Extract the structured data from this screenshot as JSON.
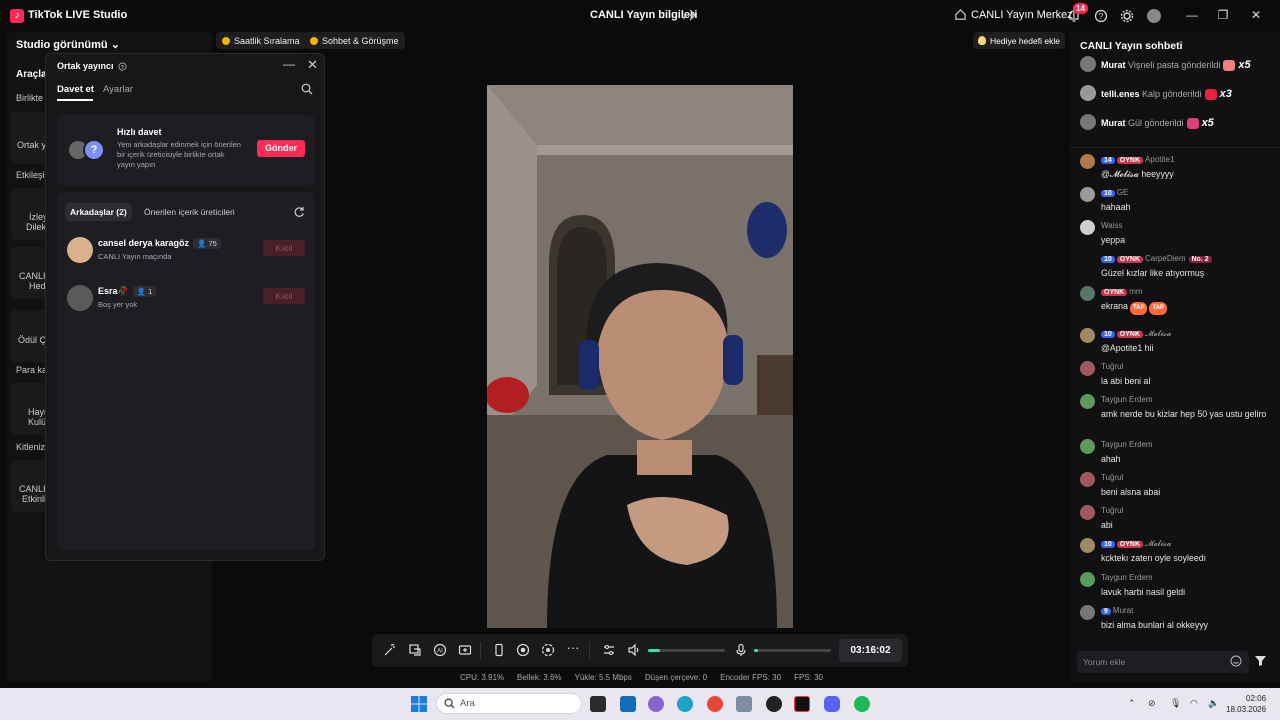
{
  "titlebar": {
    "app_title": "TikTok LIVE Studio",
    "stream_title": "CANLI Yayın bilgileri",
    "live_center": "CANLI Yayın Merkezi",
    "notification_count": "14"
  },
  "left_panel": {
    "studio_view": "Studio görünümü",
    "tools_heading": "Araçlar",
    "sections": {
      "birlikte": "Birlikte",
      "etkilesim": "Etkileşim",
      "para": "Para ka",
      "kitle": "Kitleniz"
    },
    "tiles": {
      "ortak": "Ortak y",
      "izleyici_1": "İzley",
      "izleyici_2": "Dilek",
      "canli_1": "CANLI",
      "canli_2": "Hed",
      "odul": "Ödül Ça",
      "hayran_1": "Hayr",
      "hayran_2": "Kulü",
      "canli_e_1": "CANLI",
      "canli_e_2": "Etkinli"
    }
  },
  "tags": {
    "hourly": "Saatlik Sıralama",
    "chat_meet": "Sohbet & Görüşme",
    "gift_goal": "Hediye hedefi ekle"
  },
  "popup": {
    "title": "Ortak yayıncı",
    "tab_invite": "Davet et",
    "tab_settings": "Ayarlar",
    "quick_title": "Hızlı davet",
    "quick_desc": "Yeni arkadaşlar edinmek için önerilen bir içerik üreticisiyle birlikte ortak yayın yapın",
    "send_label": "Gönder",
    "friends_tab": "Arkadaşlar (2)",
    "suggested_tab": "Önerilen içerik üreticileri",
    "friends": [
      {
        "name": "cansel derya karagöz",
        "count": "75",
        "status": "CANLI Yayın maçında",
        "join": "Katıl"
      },
      {
        "name": "Esra🥀",
        "count": "1",
        "status": "Boş yer yok",
        "join": "Katıl"
      }
    ]
  },
  "controls": {
    "timer": "03:16:02",
    "volume_level": 0.15,
    "mic_level": 0.05
  },
  "stats": {
    "cpu": "CPU:  3.91%",
    "memory": "Bellek:  3.6%",
    "upload": "Yükle:  5.5 Mbps",
    "dropped": "Düşen çerçeve:  0",
    "encoder_fps": "Encoder FPS:  30",
    "fps": "FPS:  30"
  },
  "chat": {
    "title": "CANLI Yayın sohbeti",
    "gifts": [
      {
        "name": "Murat",
        "text": "Vişneli pasta gönderildi",
        "mult": "x5",
        "color": "#f08080"
      },
      {
        "name": "telli.enes",
        "text": "Kalp gönderildi",
        "mult": "x3",
        "color": "#e6233a"
      },
      {
        "name": "Murat",
        "text": "Gül gönderildi",
        "mult": "x5",
        "color": "#e0407a"
      }
    ],
    "messages": [
      {
        "level": "14",
        "badge": "OYNK",
        "user": "Apotite1",
        "text": "@𝓜𝓮𝓵𝓲𝓼𝓪 heeyyyy",
        "color": "#b07a4a"
      },
      {
        "level": "10",
        "badge": "",
        "user": "GE",
        "text": "hahaah",
        "color": "#9a9a9a"
      },
      {
        "level": "",
        "badge": "",
        "user": "Waiss",
        "text": "yeppa",
        "color": "#cfcfcf"
      },
      {
        "level": "10",
        "badge": "OYNK",
        "user": "CarpeDiem",
        "extra": "No. 2",
        "text": "Güzel kızlar like atıyormuş",
        "color": "#111111"
      },
      {
        "level": "",
        "badge": "OYNK",
        "user": "mm",
        "text": "ekrana",
        "tap": "TAP",
        "color": "#557766"
      },
      {
        "level": "10",
        "badge": "OYNK",
        "user": "𝓜𝓮𝓵𝓲𝓼𝓪",
        "text": "@Apotite1 hii",
        "color": "#a08a60"
      },
      {
        "level": "",
        "badge": "",
        "user": "Tuğrul",
        "text": "la abi beni al",
        "color": "#9c5a5a"
      },
      {
        "level": "",
        "badge": "",
        "user": "Taygun Erdem",
        "text": "amk nerde bu kizlar hep 50 yas ustu geliro",
        "color": "#5a9a5a"
      },
      {
        "level": "",
        "badge": "",
        "user": "Taygun Erdem",
        "text": "ahah",
        "color": "#5a9a5a"
      },
      {
        "level": "",
        "badge": "",
        "user": "Tuğrul",
        "text": "beni alsna abai",
        "color": "#9c5a5a"
      },
      {
        "level": "",
        "badge": "",
        "user": "Tuğrul",
        "text": "abi",
        "color": "#9c5a5a"
      },
      {
        "level": "10",
        "badge": "OYNK",
        "user": "𝓜𝓮𝓵𝓲𝓼𝓪",
        "text": "kcktekı zaten oyle soyleedı",
        "color": "#a08a60"
      },
      {
        "level": "",
        "badge": "",
        "user": "Taygun Erdem",
        "text": "lavuk harbi nasil geldi",
        "color": "#5a9a5a"
      },
      {
        "level": "9",
        "badge": "",
        "user": "Murat",
        "text": "bizi alma bunlari al okkeyyy",
        "color": "#777777"
      }
    ],
    "input_placeholder": "Yorum ekle"
  },
  "taskbar": {
    "search": "Ara",
    "time": "02:06",
    "date": "18.03.2026"
  },
  "colors": {
    "accent": "#fe2c55",
    "slider": "#2ee6a6"
  }
}
